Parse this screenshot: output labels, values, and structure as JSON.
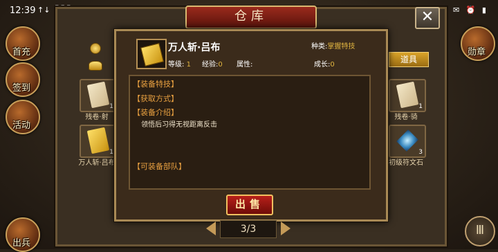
{
  "status_bar": {
    "time": "12:39",
    "signal": "↑↓ ▐▐▐",
    "right_icons": "▣ ✉ ⏰ ▮"
  },
  "left_menu": [
    {
      "label": "首充"
    },
    {
      "label": "签到"
    },
    {
      "label": "活动"
    },
    {
      "label": "出兵"
    }
  ],
  "right_menu": [
    {
      "label": "勋章"
    }
  ],
  "window": {
    "title": "仓库",
    "close_symbol": "✕"
  },
  "category_tab": "道具",
  "inventory": {
    "left_slots": [
      {
        "label": "残卷·射",
        "count": "1"
      },
      {
        "label": "万人斩·吕布",
        "count": "1"
      }
    ],
    "right_slots": [
      {
        "label": "残卷·骑",
        "count": "1"
      },
      {
        "label": "初级符文石",
        "count": "3"
      }
    ]
  },
  "item": {
    "name": "万人斩·吕布",
    "type_label": "种类:",
    "type_value": "掌握特技",
    "level_label": "等级:",
    "level_value": "1",
    "exp_label": "经验:",
    "exp_value": "0",
    "attr_label": "属性:",
    "growth_label": "成长:",
    "growth_value": "0",
    "sections": {
      "equip_skill": "【装备特技】",
      "obtain": "【获取方式】",
      "intro": "【装备介绍】",
      "intro_text": "领悟后习得无视距离反击",
      "units": "【可装备部队】"
    },
    "sell_label": "出售"
  },
  "pager": {
    "text": "3/3"
  },
  "menu_symbol": "Ⅲ"
}
